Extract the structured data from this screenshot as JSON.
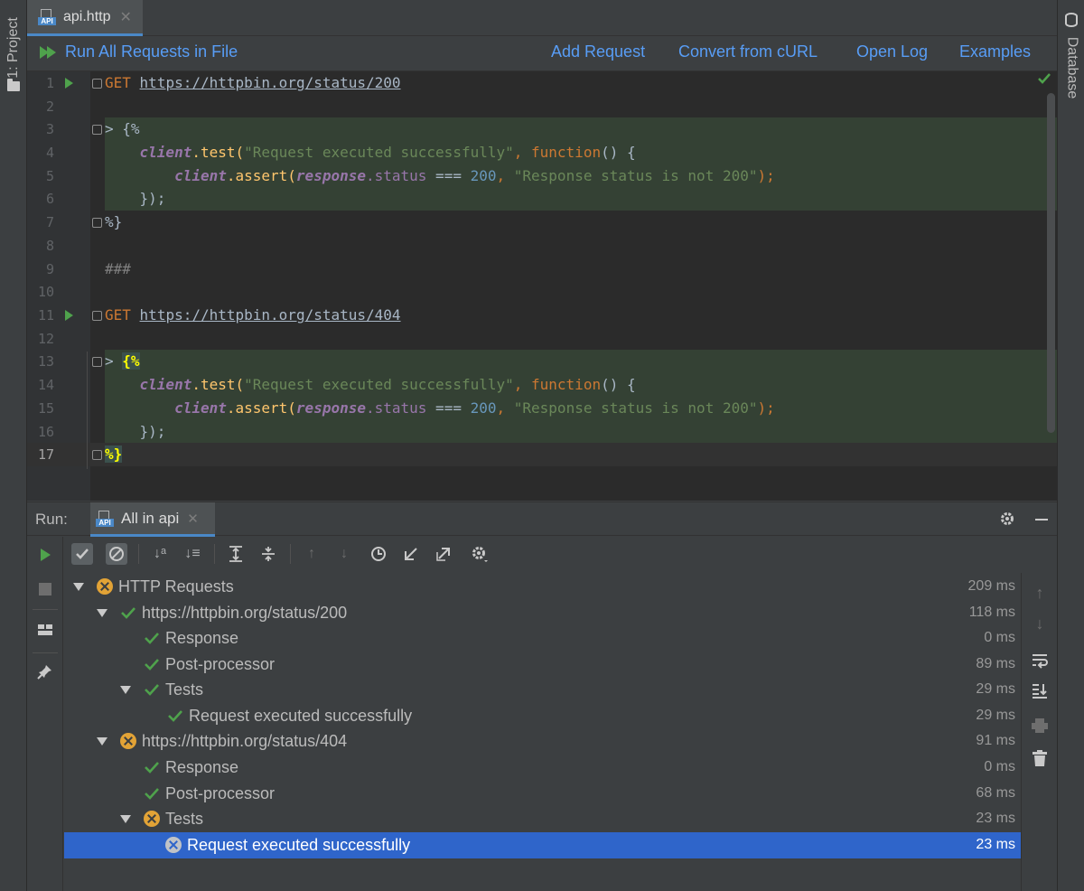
{
  "left_stripe": {
    "project_label": "1: Project"
  },
  "right_stripe": {
    "database_label": "Database"
  },
  "editor_tab": {
    "label": "api.http",
    "icon_text": "API"
  },
  "http_toolbar": {
    "run_all": "Run All Requests in File",
    "add_request": "Add Request",
    "convert_curl": "Convert from cURL",
    "open_log": "Open Log",
    "examples": "Examples"
  },
  "editor": {
    "line_numbers": [
      "1",
      "2",
      "3",
      "4",
      "5",
      "6",
      "7",
      "8",
      "9",
      "10",
      "11",
      "12",
      "13",
      "14",
      "15",
      "16",
      "17"
    ],
    "current_line": 17,
    "lines": {
      "l1_method": "GET",
      "l1_url": "https://httpbin.org/status/200",
      "open_handler": "> {%",
      "l4_client": "client",
      "l4_test": ".test(",
      "l4_str": "\"Request executed successfully\"",
      "l4_comma": ", ",
      "l4_function": "function",
      "l4_rest": "() {",
      "l5_client": "client",
      "l5_assert": ".assert(",
      "l5_response": "response",
      "l5_status": ".status",
      "l5_op": " === ",
      "l5_num": "200",
      "l5_comma": ", ",
      "l5_str": "\"Response status is not 200\"",
      "l5_end": ");",
      "l6_close": "});",
      "close_handler": "%}",
      "separator": "###",
      "l11_method": "GET",
      "l11_url": "https://httpbin.org/status/404"
    }
  },
  "run_panel": {
    "label": "Run:",
    "tab_label": "All in api",
    "tab_icon_text": "API",
    "tree": [
      {
        "label": "HTTP Requests",
        "status": "fail",
        "duration": "209 ms"
      },
      {
        "label": "https://httpbin.org/status/200",
        "status": "pass",
        "duration": "118 ms"
      },
      {
        "label": "Response",
        "status": "pass",
        "duration": "0 ms"
      },
      {
        "label": "Post-processor",
        "status": "pass",
        "duration": "89 ms"
      },
      {
        "label": "Tests",
        "status": "pass",
        "duration": "29 ms"
      },
      {
        "label": "Request executed successfully",
        "status": "pass",
        "duration": "29 ms"
      },
      {
        "label": "https://httpbin.org/status/404",
        "status": "fail",
        "duration": "91 ms"
      },
      {
        "label": "Response",
        "status": "pass",
        "duration": "0 ms"
      },
      {
        "label": "Post-processor",
        "status": "pass",
        "duration": "68 ms"
      },
      {
        "label": "Tests",
        "status": "fail",
        "duration": "23 ms"
      },
      {
        "label": "Request executed successfully",
        "status": "fail",
        "duration": "23 ms",
        "selected": true
      }
    ]
  },
  "colors": {
    "pass": "#4fa24c",
    "fail": "#e2a336",
    "selection": "#2f65ca",
    "link": "#589df6"
  }
}
